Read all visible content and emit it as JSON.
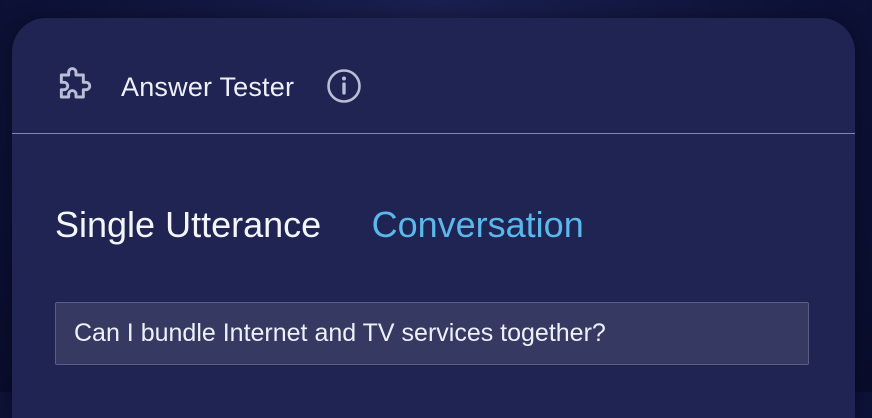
{
  "header": {
    "title": "Answer Tester",
    "title_icon": "puzzle-icon",
    "info_icon": "info-icon"
  },
  "tabs": [
    {
      "label": "Single Utterance",
      "active": true
    },
    {
      "label": "Conversation",
      "active": false
    }
  ],
  "query": {
    "value": "Can I bundle Internet and TV services together?"
  },
  "colors": {
    "background": "#0d1238",
    "panel": "#1f2453",
    "accent": "#5ab8ec",
    "input_bg": "#363a62",
    "text": "#eef0f8"
  }
}
